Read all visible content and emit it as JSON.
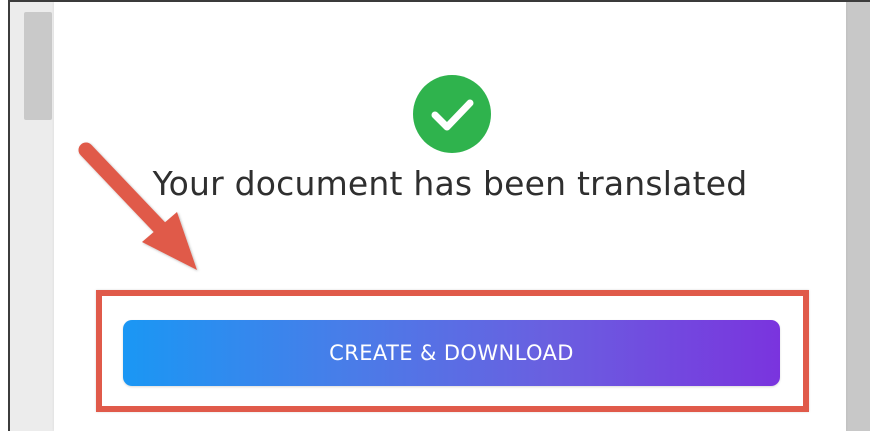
{
  "dialog": {
    "title": "Your document has been translated",
    "status_icon": "check-circle-icon",
    "primary_button_label": "CREATE & DOWNLOAD"
  },
  "annotation": {
    "arrow_icon": "arrow-icon",
    "highlight": "highlight-box"
  },
  "colors": {
    "success": "#2fb34d",
    "button_gradient_start": "#1a97f4",
    "button_gradient_end": "#7a34de",
    "annotation": "#e05a4a"
  }
}
